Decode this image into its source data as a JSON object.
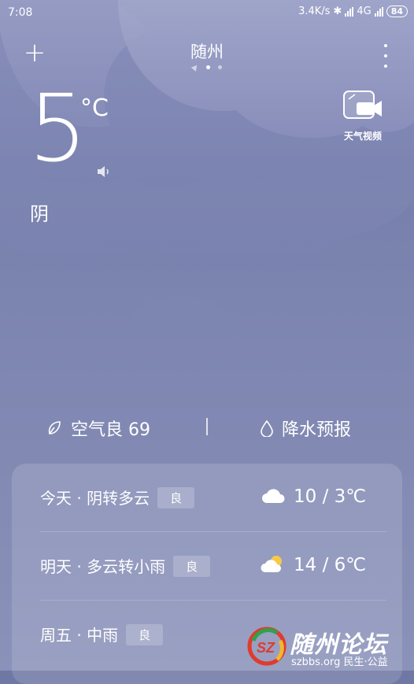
{
  "status_bar": {
    "time": "7:08",
    "net_speed": "3.4K/s",
    "network": "4G",
    "battery": "84"
  },
  "header": {
    "city": "随州",
    "pager_count": 3,
    "active_page": 1
  },
  "current": {
    "temperature": "5",
    "unit": "°C",
    "condition": "阴"
  },
  "video": {
    "label": "天气视频"
  },
  "info": {
    "aqi_text": "空气良 69",
    "rain_text": "降水预报"
  },
  "forecast": [
    {
      "desc": "今天 · 阴转多云",
      "aqi": "良",
      "icon": "cloud-icon",
      "temp": "10 / 3℃"
    },
    {
      "desc": "明天 · 多云转小雨",
      "aqi": "良",
      "icon": "partly-cloudy-icon",
      "temp": "14 / 6℃"
    },
    {
      "desc": "周五 · 中雨",
      "aqi": "良",
      "icon": "rain-icon",
      "temp": ""
    }
  ],
  "watermark": {
    "title": "随州论坛",
    "subtitle": "szbbs.org 民生·公益"
  },
  "colors": {
    "background_top": "#6f78a5",
    "background_bottom": "#8a92b9",
    "cloud": "#9aa0c6",
    "sun": "#f7c948"
  }
}
